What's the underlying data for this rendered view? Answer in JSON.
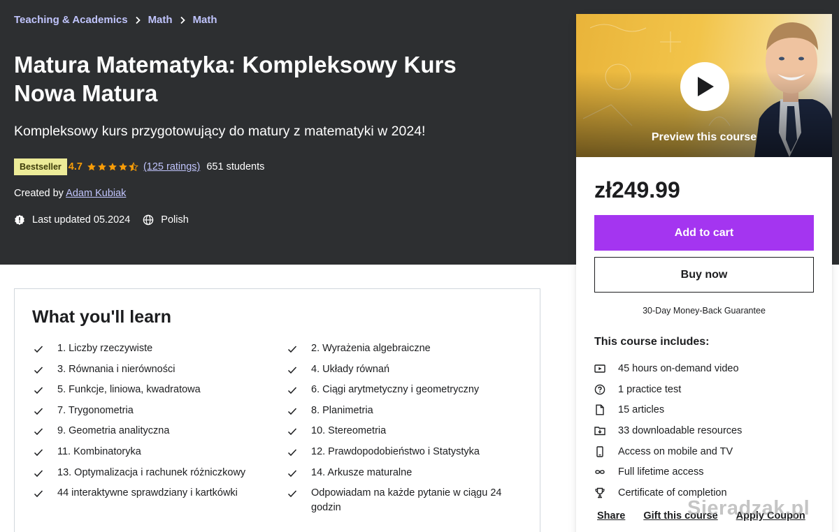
{
  "breadcrumb": [
    "Teaching & Academics",
    "Math",
    "Math"
  ],
  "course": {
    "title": "Matura Matematyka: Kompleksowy Kurs Nowa Matura",
    "subtitle": "Kompleksowy kurs przygotowujący do matury z matematyki w 2024!",
    "badge": "Bestseller",
    "rating": "4.7",
    "stars": 4.5,
    "ratings_count": "(125 ratings)",
    "students": "651 students",
    "created_by_label": "Created by",
    "author": "Adam Kubiak",
    "last_updated": "Last updated 05.2024",
    "language": "Polish"
  },
  "learn": {
    "title": "What you'll learn",
    "items": [
      "1. Liczby rzeczywiste",
      "2. Wyrażenia algebraiczne",
      "3. Równania i nierówności",
      "4. Układy równań",
      "5. Funkcje, liniowa, kwadratowa",
      "6. Ciągi arytmetyczny i geometryczny",
      "7. Trygonometria",
      "8. Planimetria",
      "9. Geometria analityczna",
      "10. Stereometria",
      "11. Kombinatoryka",
      "12. Prawdopodobieństwo i Statystyka",
      "13. Optymalizacja i rachunek różniczkowy",
      "14. Arkusze maturalne",
      "44 interaktywne sprawdziany i kartkówki",
      "Odpowiadam na każde pytanie w ciągu 24 godzin"
    ]
  },
  "sidebar": {
    "preview_label": "Preview this course",
    "price": "zł249.99",
    "add_to_cart": "Add to cart",
    "buy_now": "Buy now",
    "guarantee": "30-Day Money-Back Guarantee",
    "includes_title": "This course includes:",
    "includes": [
      {
        "icon": "video-icon",
        "text": "45 hours on-demand video"
      },
      {
        "icon": "question-circle-icon",
        "text": "1 practice test"
      },
      {
        "icon": "file-icon",
        "text": "15 articles"
      },
      {
        "icon": "download-folder-icon",
        "text": "33 downloadable resources"
      },
      {
        "icon": "mobile-icon",
        "text": "Access on mobile and TV"
      },
      {
        "icon": "infinity-icon",
        "text": "Full lifetime access"
      },
      {
        "icon": "trophy-icon",
        "text": "Certificate of completion"
      }
    ],
    "links": [
      "Share",
      "Gift this course",
      "Apply Coupon"
    ]
  },
  "watermark": "Sieradzak.pl",
  "colors": {
    "header_bg": "#2d2f31",
    "link_purple": "#c0c4fc",
    "cta_purple": "#a435f0",
    "rating_orange": "#f69c08",
    "badge_bg": "#eceb98"
  }
}
